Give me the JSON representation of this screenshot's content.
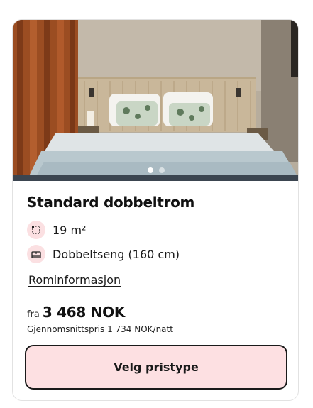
{
  "room": {
    "title": "Standard dobbeltrom",
    "features": [
      {
        "icon": "area-icon",
        "text": "19 m²"
      },
      {
        "icon": "bed-icon",
        "text": "Dobbeltseng (160 cm)"
      }
    ],
    "info_link": "Rominformasjon"
  },
  "carousel": {
    "image_count": 2,
    "active_index": 0
  },
  "price": {
    "prefix": "fra",
    "value": "3 468 NOK",
    "average": "Gjennomsnittspris 1 734 NOK/natt"
  },
  "cta": {
    "label": "Velg pristype"
  },
  "colors": {
    "accent_bg": "#fde0e2",
    "icon_bg": "#fbe0e2",
    "border": "#1a1a1a"
  }
}
